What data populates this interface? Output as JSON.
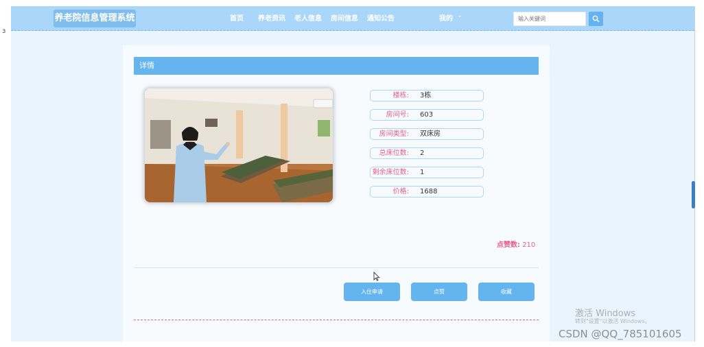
{
  "nav": {
    "brand": "养老院信息管理系统",
    "items": [
      "首页",
      "养老资讯",
      "老人信息",
      "房间信息",
      "通知公告"
    ],
    "user_menu": "我的",
    "caret": "˅",
    "search_placeholder": "输入关键词"
  },
  "detail": {
    "header": "详情",
    "fields": [
      {
        "label": "楼栋:",
        "value": "3栋"
      },
      {
        "label": "房间号:",
        "value": "603"
      },
      {
        "label": "房间类型:",
        "value": "双床房"
      },
      {
        "label": "总床位数:",
        "value": "2"
      },
      {
        "label": "剩余床位数:",
        "value": "1"
      },
      {
        "label": "价格:",
        "value": "1688"
      }
    ],
    "likes_label": "点赞数:",
    "likes_value": "210"
  },
  "actions": {
    "apply": "入住申请",
    "like": "点赞",
    "favorite": "收藏"
  },
  "system": {
    "activation_title": "激活 Windows",
    "activation_sub": "转到\"设置\"以激活 Windows。",
    "credit": "CSDN @QQ_785101605"
  },
  "colors": {
    "nav_bg": "#a9d6f9",
    "accent": "#64b4f0",
    "label_pink": "#e45d8e"
  }
}
